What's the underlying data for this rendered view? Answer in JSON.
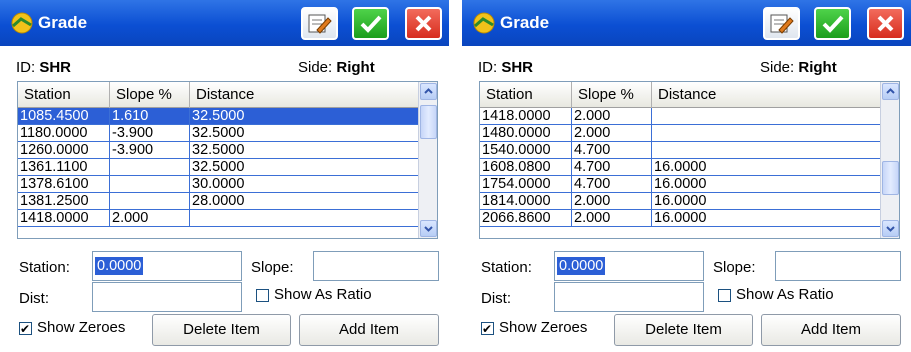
{
  "windows": [
    {
      "title": "Grade",
      "id_label": "ID:",
      "id_value": "SHR",
      "side_label": "Side:",
      "side_value": "Right",
      "columns": [
        "Station",
        "Slope %",
        "Distance"
      ],
      "rows": [
        [
          "1085.4500",
          "1.610",
          "32.5000"
        ],
        [
          "1180.0000",
          "-3.900",
          "32.5000"
        ],
        [
          "1260.0000",
          "-3.900",
          "32.5000"
        ],
        [
          "1361.1100",
          "",
          "32.5000"
        ],
        [
          "1378.6100",
          "",
          "30.0000"
        ],
        [
          "1381.2500",
          "",
          "28.0000"
        ],
        [
          "1418.0000",
          "2.000",
          ""
        ]
      ],
      "selected_row": 0,
      "station_label": "Station:",
      "station_value": "0.0000",
      "slope_label": "Slope:",
      "slope_value": "",
      "dist_label": "Dist:",
      "dist_value": "",
      "show_as_ratio_label": "Show As Ratio",
      "show_as_ratio_checked": false,
      "show_zeroes_label": "Show Zeroes",
      "show_zeroes_checked": true,
      "delete_label": "Delete Item",
      "add_label": "Add Item",
      "scroll_fraction": 0.05
    },
    {
      "title": "Grade",
      "id_label": "ID:",
      "id_value": "SHR",
      "side_label": "Side:",
      "side_value": "Right",
      "columns": [
        "Station",
        "Slope %",
        "Distance"
      ],
      "rows": [
        [
          "1418.0000",
          "2.000",
          ""
        ],
        [
          "1480.0000",
          "2.000",
          ""
        ],
        [
          "1540.0000",
          "4.700",
          ""
        ],
        [
          "1608.0800",
          "4.700",
          "16.0000"
        ],
        [
          "1754.0000",
          "4.700",
          "16.0000"
        ],
        [
          "1814.0000",
          "2.000",
          "16.0000"
        ],
        [
          "2066.8600",
          "2.000",
          "16.0000"
        ]
      ],
      "selected_row": -1,
      "station_label": "Station:",
      "station_value": "0.0000",
      "slope_label": "Slope:",
      "slope_value": "",
      "dist_label": "Dist:",
      "dist_value": "",
      "show_as_ratio_label": "Show As Ratio",
      "show_as_ratio_checked": false,
      "show_zeroes_label": "Show Zeroes",
      "show_zeroes_checked": true,
      "delete_label": "Delete Item",
      "add_label": "Add Item",
      "scroll_fraction": 0.72
    }
  ]
}
